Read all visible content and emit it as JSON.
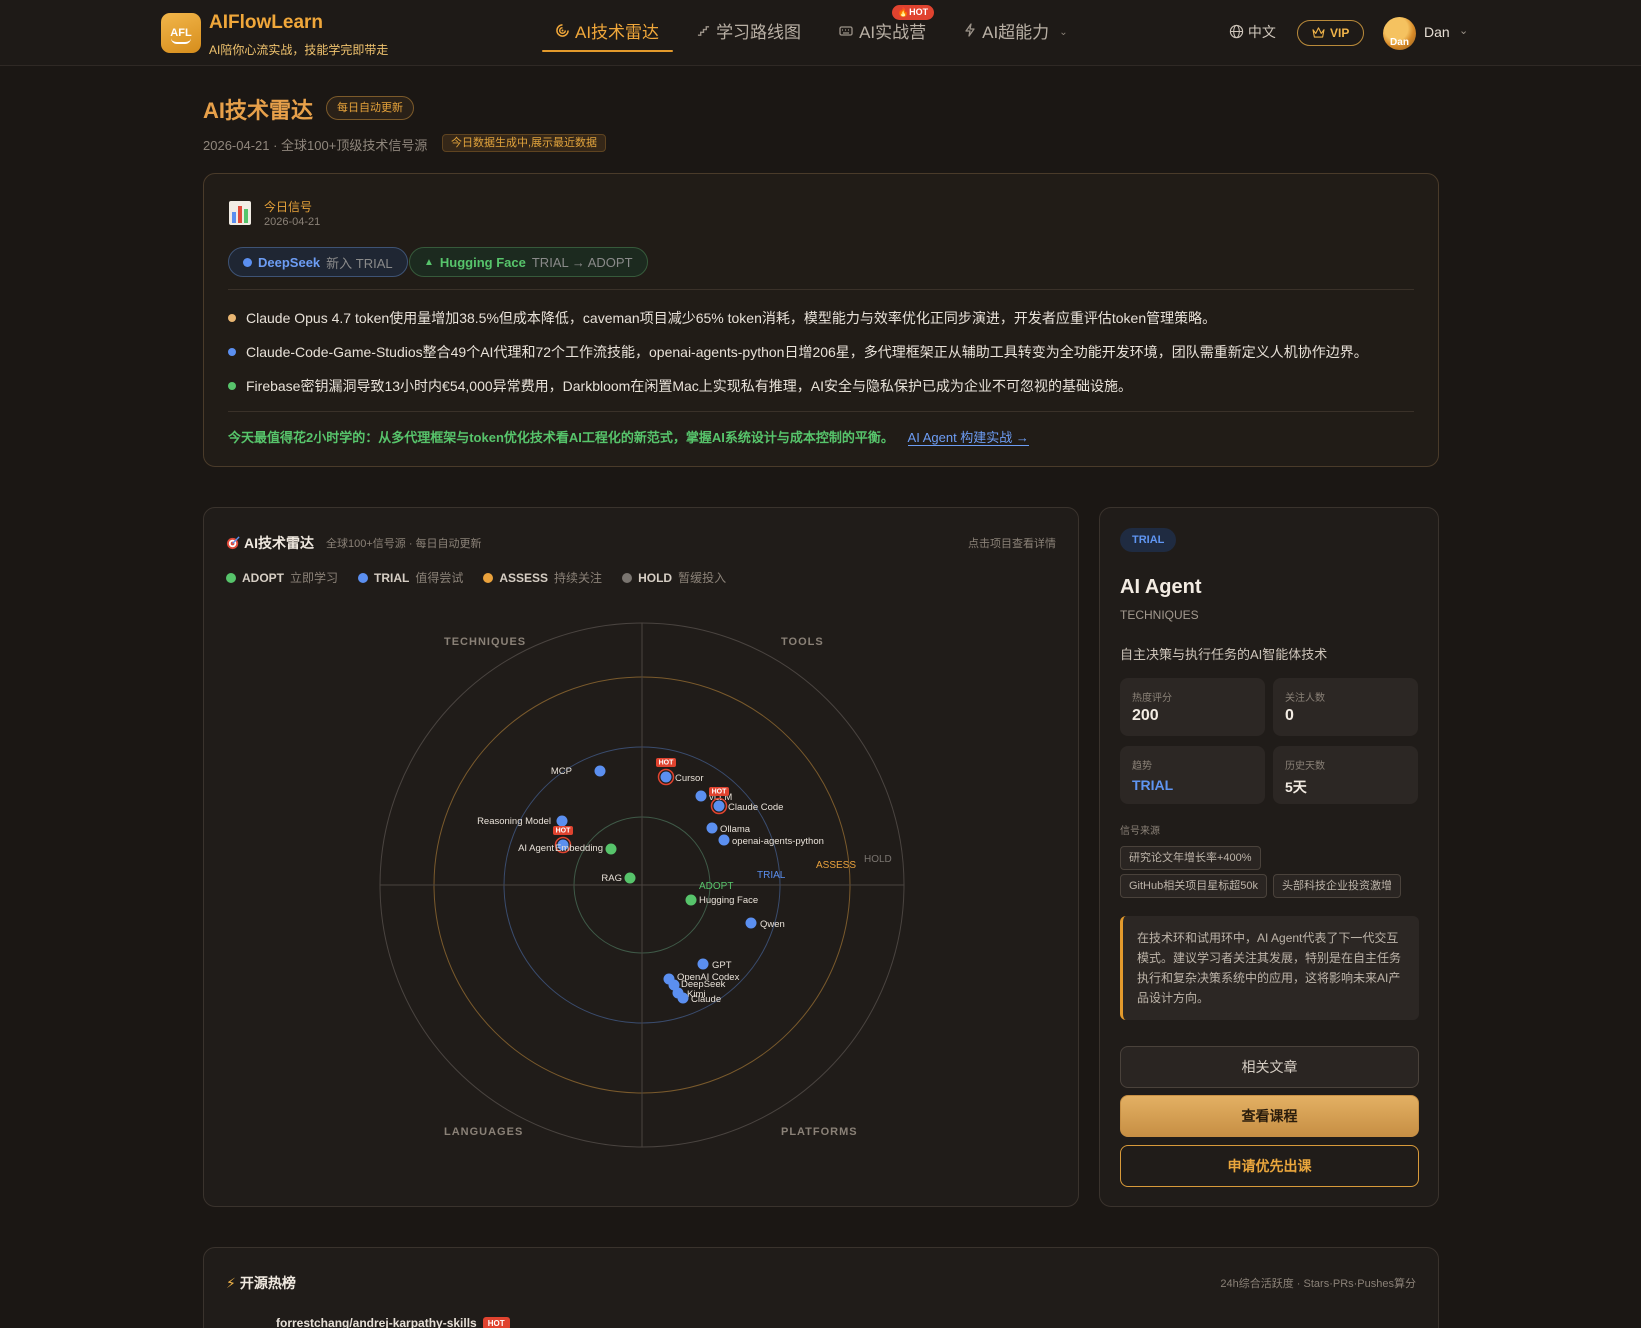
{
  "brand": {
    "logo_text": "AFL",
    "title": "AIFlowLearn",
    "subtitle": "AI陪你心流实战，技能学完即带走"
  },
  "nav": {
    "items": [
      {
        "label": "AI技术雷达",
        "icon": "radar-icon"
      },
      {
        "label": "学习路线图",
        "icon": "stairs-icon"
      },
      {
        "label": "AI实战营",
        "icon": "keyboard-icon",
        "badge": "🔥HOT"
      },
      {
        "label": "AI超能力",
        "icon": "bolt-icon"
      }
    ],
    "lang": "中文",
    "vip": "VIP",
    "user": {
      "avatar_text": "Dan",
      "name": "Dan"
    }
  },
  "page": {
    "title": "AI技术雷达",
    "daily_pill": "每日自动更新",
    "subtitle": "2026-04-21 · 全球100+顶级技术信号源",
    "gen_pill": "今日数据生成中,展示最近数据"
  },
  "signal": {
    "label": "今日信号",
    "date": "2026-04-21",
    "chips": [
      {
        "name": "DeepSeek",
        "meta": "新入 TRIAL"
      },
      {
        "name": "Hugging Face",
        "meta": "TRIAL → ADOPT"
      }
    ],
    "bullets": [
      {
        "text": "Claude Opus 4.7 token使用量增加38.5%但成本降低，caveman项目减少65% token消耗，模型能力与效率优化正同步演进，开发者应重评估token管理策略。",
        "color": "#e9b672"
      },
      {
        "text": "Claude-Code-Game-Studios整合49个AI代理和72个工作流技能，openai-agents-python日增206星，多代理框架正从辅助工具转变为全功能开发环境，团队需重新定义人机协作边界。",
        "color": "#5b8ff0"
      },
      {
        "text": "Firebase密钥漏洞导致13小时内€54,000异常费用，Darkbloom在闲置Mac上实现私有推理，AI安全与隐私保护已成为企业不可忽视的基础设施。",
        "color": "#57c46b"
      }
    ],
    "footer": "今天最值得花2小时学的：从多代理框架与token优化技术看AI工程化的新范式，掌握AI系统设计与成本控制的平衡。",
    "footer_link": "AI Agent 构建实战 →"
  },
  "radar": {
    "title": "AI技术雷达",
    "subtitle": "全球100+信号源 · 每日自动更新",
    "hint": "点击项目查看详情",
    "legend": [
      {
        "name": "ADOPT",
        "hint": "立即学习",
        "color": "#57c46b"
      },
      {
        "name": "TRIAL",
        "hint": "值得尝试",
        "color": "#5b8ff0"
      },
      {
        "name": "ASSESS",
        "hint": "持续关注",
        "color": "#eaa23c"
      },
      {
        "name": "HOLD",
        "hint": "暂缓投入",
        "color": "#7a7570"
      }
    ],
    "quadrants": [
      "TECHNIQUES",
      "TOOLS",
      "LANGUAGES",
      "PLATFORMS"
    ],
    "rings": [
      "ADOPT",
      "TRIAL",
      "ASSESS",
      "HOLD"
    ],
    "hot_label": "HOT",
    "blips": [
      {
        "name": "MCP",
        "ring": "TRIAL",
        "hot": false
      },
      {
        "name": "Cursor",
        "ring": "TRIAL",
        "hot": true
      },
      {
        "name": "vLLM",
        "ring": "TRIAL",
        "hot": false
      },
      {
        "name": "Claude Code",
        "ring": "TRIAL",
        "hot": true
      },
      {
        "name": "Reasoning Model",
        "ring": "TRIAL",
        "hot": false
      },
      {
        "name": "Ollama",
        "ring": "TRIAL",
        "hot": false
      },
      {
        "name": "openai-agents-python",
        "ring": "TRIAL",
        "hot": false
      },
      {
        "name": "AI Agent",
        "ring": "TRIAL",
        "hot": true
      },
      {
        "name": "Embedding",
        "ring": "ADOPT",
        "hot": false
      },
      {
        "name": "RAG",
        "ring": "ADOPT",
        "hot": false
      },
      {
        "name": "Hugging Face",
        "ring": "ADOPT",
        "hot": false
      },
      {
        "name": "Qwen",
        "ring": "TRIAL",
        "hot": false
      },
      {
        "name": "GPT",
        "ring": "TRIAL",
        "hot": false
      },
      {
        "name": "OpenAI Codex",
        "ring": "TRIAL",
        "hot": false
      },
      {
        "name": "DeepSeek",
        "ring": "TRIAL",
        "hot": false
      },
      {
        "name": "Kimi",
        "ring": "TRIAL",
        "hot": false
      },
      {
        "name": "Claude",
        "ring": "TRIAL",
        "hot": false
      }
    ]
  },
  "detail": {
    "tag": "TRIAL",
    "name": "AI Agent",
    "category": "TECHNIQUES",
    "desc": "自主决策与执行任务的AI智能体技术",
    "stats": [
      {
        "label": "热度评分",
        "value": "200"
      },
      {
        "label": "关注人数",
        "value": "0"
      },
      {
        "label": "趋势",
        "value": "TRIAL"
      },
      {
        "label": "历史天数",
        "value": "5天"
      }
    ],
    "src_label": "信号来源",
    "sources": [
      "研究论文年增长率+400%",
      "GitHub相关项目星标超50k",
      "头部科技企业投资激增"
    ],
    "note": "在技术环和试用环中，AI Agent代表了下一代交互模式。建议学习者关注其发展，特别是在自主任务执行和复杂决策系统中的应用，这将影响未来AI产品设计方向。",
    "btn_articles": "相关文章",
    "btn_course": "查看课程",
    "btn_priority": "申请优先出课"
  },
  "opensource": {
    "title": "开源热榜",
    "hint": "24h综合活跃度 · Stars·PRs·Pushes算分",
    "first_repo": "forrestchang/andrej-karpathy-skills",
    "hot": "HOT"
  }
}
